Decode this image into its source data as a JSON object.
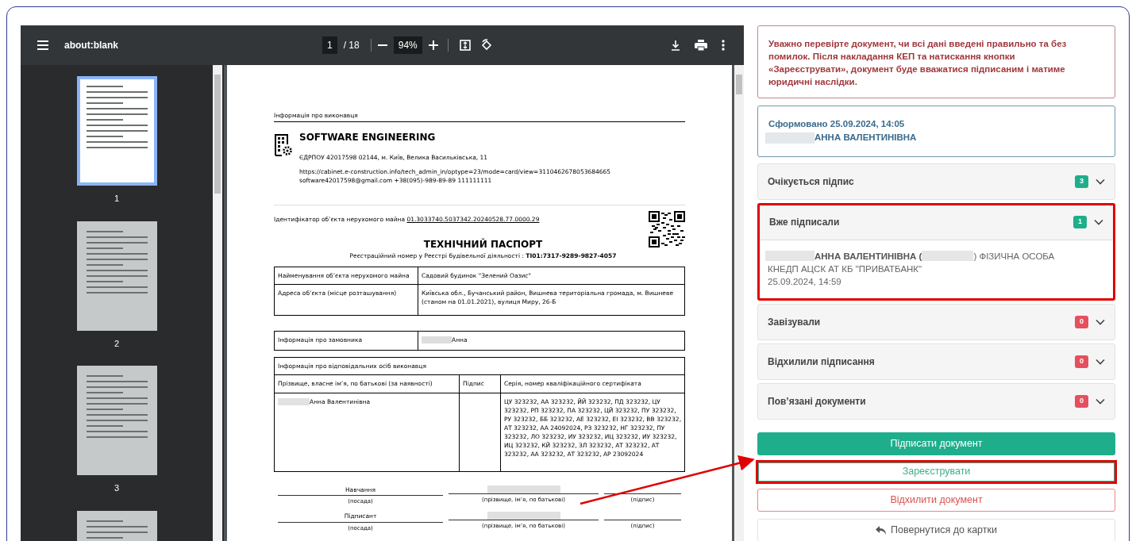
{
  "viewer": {
    "title": "about:blank",
    "page": "1",
    "page_total": "/ 18",
    "zoom": "94%",
    "thumbnails": [
      {
        "label": "1",
        "selected": true
      },
      {
        "label": "2",
        "selected": false
      },
      {
        "label": "3",
        "selected": false
      },
      {
        "selected": false
      }
    ]
  },
  "document": {
    "section_heading": "Інформація про виконавця",
    "company": "SOFTWARE ENGINEERING",
    "company_details": [
      "ЄДРПОУ 42017598 02144, м. Київ, Велика Васильківська, 11",
      "https://cabinet.e-construction.info/tech_admin_in/optype=23/mode=card/view=3110462678053684665",
      "software42017598@gmail.com +38(095)-989-89-89 111111111"
    ],
    "identifier_label": "Ідентифікатор об’єкта нерухомого майна",
    "identifier_value": "01.3033740.5037342.20240528.77.0000.29",
    "title": "ТЕХНІЧНИЙ ПАСПОРТ",
    "registry_line": "Реєстраційний номер у Реєстрі будівельної діяльності : **ТІ01:7317-9289-9827-4057**",
    "property_rows": [
      [
        "Найменування об’єкта нерухомого майна",
        "Садовий будинок \"Зелений Оазис\""
      ],
      [
        "Адреса об’єкта (місце розташування)",
        "Київська обл., Бучанський район, Вишнева територіальна громада, м. Вишневе (станом на 01.01.2021), вулиця Миру, 26-Б"
      ]
    ],
    "customer": {
      "label": "Інформація про замовника",
      "value": "Анна",
      "redacted": true
    },
    "responsible": {
      "heading": "Інформація про відповідальних осіб виконавця",
      "columns": [
        "Прізвище, власне ім’я, по батькові (за наявності)",
        "Підпис",
        "Серія, номер кваліфікаційного сертифіката"
      ],
      "rows": [
        {
          "name": "Анна Валентинівна",
          "redacted": true,
          "certificates": "ЦУ 323232, АА 323232, ЙЙ 323232, ПД 323232, ЦУ 323232, РП 323232, ПА 323232, ЦЙ 323232, ПУ 323232, РУ 323232, ББ 323232, АЕ 323232, ЕІ 323232, ВВ 323232, АТ 323232, АА 24092024, РЗ 323232, НГ 323232, ПУ 323232, ЛО 323232, ИУ 323232, ИЦ 323232, ИУ 323232, ИЦ 323232, КЙ 323232, ЗЛ 323232, АТ 323232, АТ 323232, АА 323232, АТ 323232, АР 23092024"
        }
      ]
    },
    "signature_rows": [
      {
        "role": "Навчання",
        "redacted": true,
        "position_caption": "(посада)",
        "name_caption": "(прізвище, ім’я, по батькові)",
        "signature_caption": "(підпис)"
      },
      {
        "role": "Підписант",
        "redacted": true,
        "position_caption": "(посада)",
        "name_caption": "(прізвище, ім’я, по батькові)",
        "signature_caption": "(підпис)"
      }
    ]
  },
  "panel": {
    "warning": "Уважно перевірте документ, чи всі дані введені правильно та без помилок. Після накладання КЕП та натискання кнопки «Зареєструвати», документ буде вважатися підписаним і матиме юридичні наслідки.",
    "created": {
      "line": "Сформовано 25.09.2024, 14:05",
      "author": "АННА ВАЛЕНТИНІВНА",
      "redacted": true
    },
    "sections": [
      {
        "title": "Очікується підпис",
        "count": "3",
        "color": "#1fae8c",
        "expanded": false,
        "highlighted": false
      },
      {
        "title": "Вже підписали",
        "count": "1",
        "color": "#1fae8c",
        "expanded": true,
        "highlighted": true,
        "entries": [
          {
            "signer": "АННА ВАЛЕНТИНІВНА (",
            "signer_type": ") ФІЗИЧНА ОСОБА",
            "issuer": "КНЕДП АЦСК АТ КБ \"ПРИВАТБАНК\"",
            "time": "25.09.2024, 14:59"
          }
        ]
      },
      {
        "title": "Завізували",
        "count": "0",
        "color": "#e5505f",
        "expanded": false,
        "highlighted": false
      },
      {
        "title": "Відхилили підписання",
        "count": "0",
        "color": "#e5505f",
        "expanded": false,
        "highlighted": false
      },
      {
        "title": "Пов’язані документи",
        "count": "0",
        "color": "#e5505f",
        "expanded": false,
        "highlighted": false
      }
    ],
    "buttons": [
      {
        "label": "Підписати документ",
        "kind": "primary",
        "highlighted": false
      },
      {
        "label": "Зареєструвати",
        "kind": "success-outline",
        "highlighted": true
      },
      {
        "label": "Відхилити документ",
        "kind": "danger-outline",
        "highlighted": false
      },
      {
        "label": "Повернутися до картки",
        "kind": "back",
        "highlighted": false
      }
    ]
  }
}
